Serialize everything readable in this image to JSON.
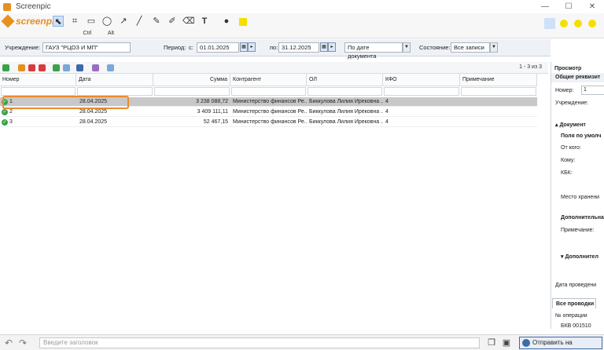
{
  "window": {
    "title": "Screenpic",
    "minimize": "—",
    "maximize": "☐",
    "close": "✕"
  },
  "screenpic": {
    "logo": "screenpic",
    "tools": {
      "select": "⬉",
      "crop": "⌗",
      "rect": "▭",
      "ellipse": "◯",
      "arrow": "↗",
      "line": "╱",
      "pen": "✎",
      "marker": "✐",
      "eraser": "⌫",
      "text": "T",
      "drop": "●",
      "highlight_color": "#f4e000",
      "ctrl_label": "Ctrl",
      "alt_label": "Alt"
    }
  },
  "filter": {
    "institution_label": "Учреждение:",
    "institution_value": "ГАУЗ \"РЦОЗ И МП\"",
    "period_label": "Период:",
    "from_label": "с:",
    "from_value": "01.01.2025",
    "to_label": "по:",
    "to_value": "31.12.2025",
    "date_mode": "По дате документа",
    "state_label": "Состояние:",
    "state_value": "Все записи"
  },
  "list": {
    "pager": "1 - 3 из 3",
    "columns": [
      "Номер",
      "Дата",
      "Сумма",
      "Контрагент",
      "ОЛ",
      "КФО",
      "Примечание"
    ],
    "rows": [
      {
        "num": "1",
        "date": "28.04.2025",
        "sum": "3 238 088,72",
        "contragent": "Министерство финансов Ре...",
        "ol": "Биккулова Лилия Ирековна ...",
        "kfo": "4",
        "note": ""
      },
      {
        "num": "2",
        "date": "28.04.2025",
        "sum": "3 409 111,11",
        "contragent": "Министерство финансов Ре...",
        "ol": "Биккулова Лилия Ирековна ...",
        "kfo": "4",
        "note": ""
      },
      {
        "num": "3",
        "date": "28.04.2025",
        "sum": "52 467,15",
        "contragent": "Министерство финансов Ре...",
        "ol": "Биккулова Лилия Ирековна ...",
        "kfo": "4",
        "note": ""
      }
    ]
  },
  "panel": {
    "title": "Просмотр",
    "general": "Общие реквизит",
    "number_label": "Номер:",
    "number_value": "1",
    "institution_label": "Учреждение:",
    "document_section": "Документ",
    "default_fields": "Поля по умолч",
    "from_whom": "От кого:",
    "to_whom": "Кому:",
    "kbk": "КБК:",
    "storage": "Место хранени",
    "additional": "Дополнительна",
    "note": "Примечание:",
    "additional2": "Дополнител",
    "date_posting": "Дата проведени",
    "tab_all_postings": "Все проводки",
    "op_number_label": "№ операции",
    "op_number_value": "БКВ 001510"
  },
  "bottom": {
    "caption_placeholder": "Введите заголовок",
    "upload_label": "Отправить на Imgur.com"
  }
}
